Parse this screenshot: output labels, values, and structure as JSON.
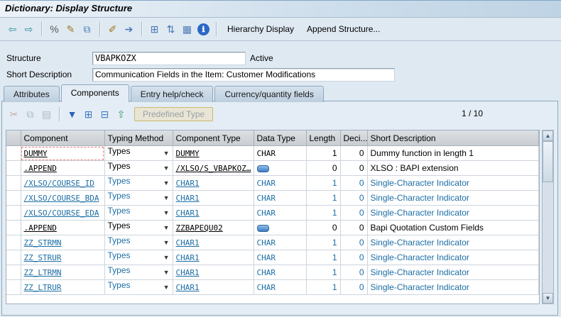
{
  "titlebar": {
    "title": "Dictionary: Display Structure"
  },
  "main_toolbar": {
    "groups": [
      {
        "icons": [
          {
            "name": "back-icon",
            "glyph": "⇦",
            "color": "#2f8fa0"
          },
          {
            "name": "forward-icon",
            "glyph": "⇨",
            "color": "#2f8fa0"
          }
        ]
      },
      {
        "icons": [
          {
            "name": "where-used-icon",
            "glyph": "%",
            "color": "#555555"
          },
          {
            "name": "display-change-icon",
            "glyph": "✎",
            "color": "#a07820"
          },
          {
            "name": "copy-icon",
            "glyph": "⧉",
            "color": "#4a7ab5"
          }
        ]
      },
      {
        "icons": [
          {
            "name": "pencil-icon",
            "glyph": "✐",
            "color": "#a07820"
          },
          {
            "name": "transport-icon",
            "glyph": "➔",
            "color": "#4a7ab5"
          }
        ]
      },
      {
        "icons": [
          {
            "name": "hierarchy-icon",
            "glyph": "⊞",
            "color": "#4a7ab5"
          },
          {
            "name": "sort-icon",
            "glyph": "⇅",
            "color": "#4a7ab5"
          },
          {
            "name": "grid-icon",
            "glyph": "▦",
            "color": "#4a7ab5"
          },
          {
            "name": "info-icon",
            "glyph": "ℹ",
            "color": "#ffffff",
            "bg": "#2a67c6"
          }
        ]
      }
    ],
    "buttons": [
      {
        "name": "hierarchy-display-button",
        "label": "Hierarchy Display"
      },
      {
        "name": "append-structure-button",
        "label": "Append Structure..."
      }
    ]
  },
  "form": {
    "structure_label": "Structure",
    "structure_value": "VBAPKOZX",
    "status": "Active",
    "short_desc_label": "Short Description",
    "short_desc_value": "Communication Fields in the Item: Customer Modifications"
  },
  "tabs": [
    {
      "label": "Attributes"
    },
    {
      "label": "Components"
    },
    {
      "label": "Entry help/check"
    },
    {
      "label": "Currency/quantity fields"
    }
  ],
  "panel": {
    "toolbar": {
      "groups": [
        {
          "icons": [
            {
              "name": "cut-icon",
              "glyph": "✂",
              "color": "#b05050",
              "disabled": true
            },
            {
              "name": "copy-rows-icon",
              "glyph": "⧉",
              "color": "#64788a",
              "disabled": true
            },
            {
              "name": "paste-icon",
              "glyph": "▤",
              "color": "#64788a",
              "disabled": true
            }
          ]
        },
        {
          "icons": [
            {
              "name": "filter-icon",
              "glyph": "▼",
              "color": "#2a62b8"
            },
            {
              "name": "insert-row-icon",
              "glyph": "⊞",
              "color": "#3f7cc4"
            },
            {
              "name": "delete-row-icon",
              "glyph": "⊟",
              "color": "#3f7cc4"
            },
            {
              "name": "move-up-icon",
              "glyph": "⇧",
              "color": "#3a9a6a"
            }
          ]
        }
      ],
      "predefined_label": "Predefined Type",
      "position": "1 / 10"
    },
    "table": {
      "columns": [
        "Component",
        "Typing Method",
        "Component Type",
        "Data Type",
        "Length",
        "Deci...",
        "Short Description"
      ],
      "rows": [
        {
          "component": "DUMMY",
          "typing": "Types",
          "type": "DUMMY",
          "data_type": "CHAR",
          "length": "1",
          "dec": "0",
          "desc": "Dummy function in length 1",
          "tone": "black",
          "append": false,
          "cursor": true
        },
        {
          "component": ".APPEND",
          "typing": "Types",
          "type": "/XLSO/S_VBAPKOZ…",
          "data_type": "",
          "length": "0",
          "dec": "0",
          "desc": "XLSO : BAPI extension",
          "tone": "black",
          "append": true,
          "cursor": false
        },
        {
          "component": "/XLSO/COURSE_ID",
          "typing": "Types",
          "type": "CHAR1",
          "data_type": "CHAR",
          "length": "1",
          "dec": "0",
          "desc": "Single-Character Indicator",
          "tone": "blue",
          "append": false,
          "cursor": false
        },
        {
          "component": "/XLSO/COURSE_BDA",
          "typing": "Types",
          "type": "CHAR1",
          "data_type": "CHAR",
          "length": "1",
          "dec": "0",
          "desc": "Single-Character Indicator",
          "tone": "blue",
          "append": false,
          "cursor": false
        },
        {
          "component": "/XLSO/COURSE_EDA",
          "typing": "Types",
          "type": "CHAR1",
          "data_type": "CHAR",
          "length": "1",
          "dec": "0",
          "desc": "Single-Character Indicator",
          "tone": "blue",
          "append": false,
          "cursor": false
        },
        {
          "component": ".APPEND",
          "typing": "Types",
          "type": "ZZBAPEQU02",
          "data_type": "",
          "length": "0",
          "dec": "0",
          "desc": "Bapi Quotation Custom Fields",
          "tone": "black",
          "append": true,
          "cursor": false
        },
        {
          "component": "ZZ_STRMN",
          "typing": "Types",
          "type": "CHAR1",
          "data_type": "CHAR",
          "length": "1",
          "dec": "0",
          "desc": "Single-Character Indicator",
          "tone": "blue",
          "append": false,
          "cursor": false
        },
        {
          "component": "ZZ_STRUR",
          "typing": "Types",
          "type": "CHAR1",
          "data_type": "CHAR",
          "length": "1",
          "dec": "0",
          "desc": "Single-Character Indicator",
          "tone": "blue",
          "append": false,
          "cursor": false
        },
        {
          "component": "ZZ_LTRMN",
          "typing": "Types",
          "type": "CHAR1",
          "data_type": "CHAR",
          "length": "1",
          "dec": "0",
          "desc": "Single-Character Indicator",
          "tone": "blue",
          "append": false,
          "cursor": false
        },
        {
          "component": "ZZ_LTRUR",
          "typing": "Types",
          "type": "CHAR1",
          "data_type": "CHAR",
          "length": "1",
          "dec": "0",
          "desc": "Single-Character Indicator",
          "tone": "blue",
          "append": false,
          "cursor": false
        }
      ]
    },
    "scrollbar": {
      "up": "▲",
      "down": "▼"
    }
  }
}
